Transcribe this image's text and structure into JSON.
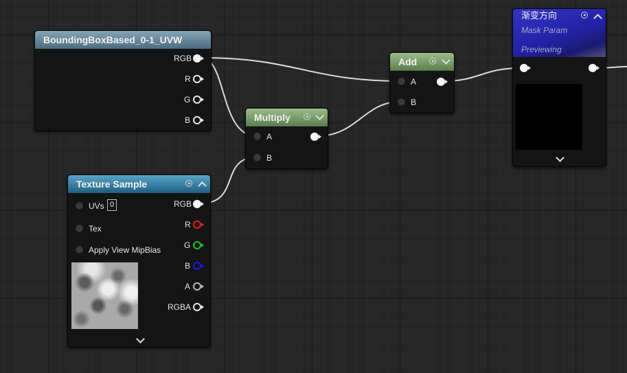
{
  "nodes": {
    "bbox": {
      "title": "BoundingBoxBased_0-1_UVW",
      "outputs": [
        "RGB",
        "R",
        "G",
        "B"
      ]
    },
    "multiply": {
      "title": "Multiply",
      "inputs": [
        "A",
        "B"
      ]
    },
    "add": {
      "title": "Add",
      "inputs": [
        "A",
        "B"
      ]
    },
    "mask": {
      "title": "渐变方向",
      "subtitle": "Mask Param",
      "status": "Previewing"
    },
    "texture": {
      "title": "Texture Sample",
      "inputs": [
        "UVs",
        "Tex",
        "Apply View MipBias"
      ],
      "uvs_value": "0",
      "outputs": [
        "RGB",
        "R",
        "G",
        "B",
        "A",
        "RGBA"
      ]
    }
  },
  "colors": {
    "bbox_header": "#5f7f93",
    "multiply_header": "#6f9561",
    "add_header": "#6f9561",
    "mask_header": "#2a2aa8",
    "texture_header": "#2f7aa0",
    "pin_r": "#e0201e",
    "pin_g": "#1fc21f",
    "pin_b": "#1a1ae0",
    "wire": "#dcdcdc"
  }
}
